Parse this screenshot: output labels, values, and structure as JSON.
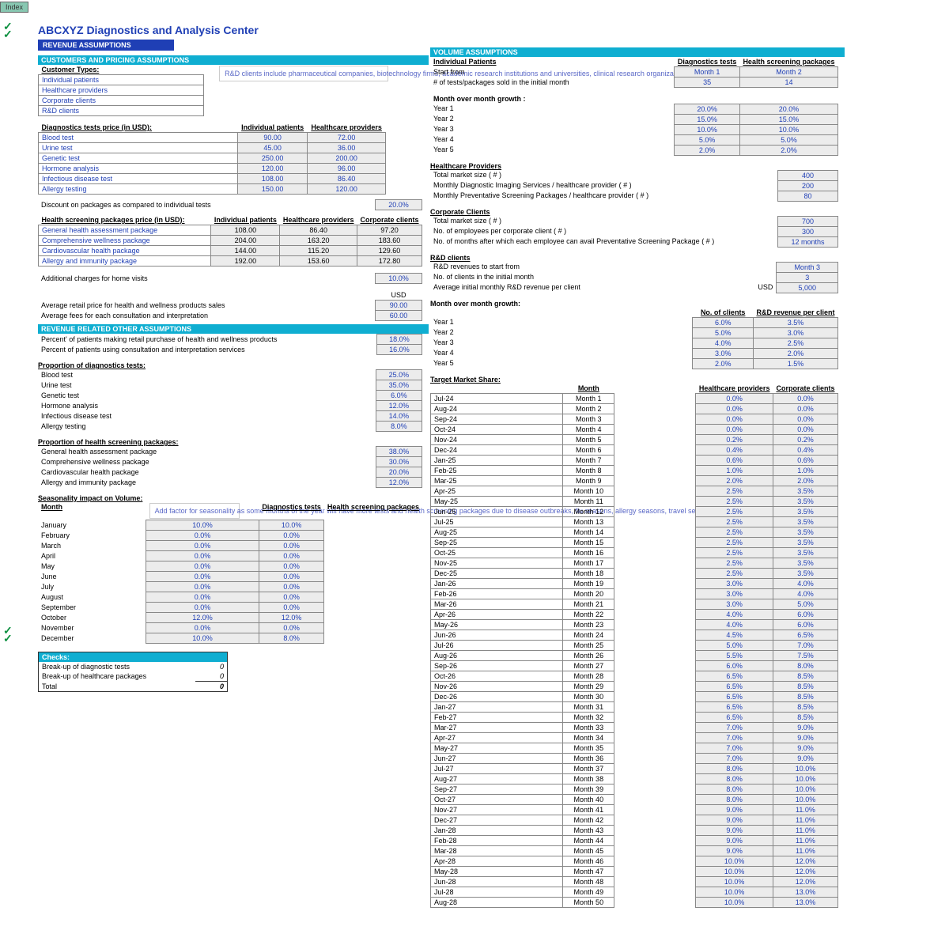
{
  "index_tab": "Index",
  "page_title": "ABCXYZ Diagnostics and Analysis Center",
  "section": "REVENUE ASSUMPTIONS",
  "left": {
    "cpa": "CUSTOMERS AND PRICING ASSUMPTIONS",
    "cust_types_hdr": "Customer Types:",
    "cust_types": [
      "Individual patients",
      "Healthcare providers",
      "Corporate clients",
      "R&D clients"
    ],
    "rnd_note": "R&D clients include pharmaceutical companies, biotechnology firms, academic research institutions and universities, clinical research organizations and non-profit organizations and foundations",
    "diag_hdr": "Diagnostics tests price (in USD):",
    "diag_cols": [
      "Individual patients",
      "Healthcare providers"
    ],
    "diag_rows": [
      {
        "n": "Blood test",
        "ip": "90.00",
        "hp": "72.00"
      },
      {
        "n": "Urine test",
        "ip": "45.00",
        "hp": "36.00"
      },
      {
        "n": "Genetic test",
        "ip": "250.00",
        "hp": "200.00"
      },
      {
        "n": "Hormone analysis",
        "ip": "120.00",
        "hp": "96.00"
      },
      {
        "n": "Infectious disease test",
        "ip": "108.00",
        "hp": "86.40"
      },
      {
        "n": "Allergy testing",
        "ip": "150.00",
        "hp": "120.00"
      }
    ],
    "discount_label": "Discount on packages as compared to individual tests",
    "discount_val": "20.0%",
    "pkg_hdr": "Health screening packages price (in USD):",
    "pkg_cols": [
      "Individual patients",
      "Healthcare providers",
      "Corporate clients"
    ],
    "pkg_rows": [
      {
        "n": "General health assessment package",
        "ip": "108.00",
        "hp": "86.40",
        "cc": "97.20"
      },
      {
        "n": "Comprehensive wellness package",
        "ip": "204.00",
        "hp": "163.20",
        "cc": "183.60"
      },
      {
        "n": "Cardiovascular health package",
        "ip": "144.00",
        "hp": "115.20",
        "cc": "129.60"
      },
      {
        "n": "Allergy and immunity package",
        "ip": "192.00",
        "hp": "153.60",
        "cc": "172.80"
      }
    ],
    "home_label": "Additional charges for home visits",
    "home_val": "10.0%",
    "avg_retail_label": "Average retail price for health and wellness products sales",
    "avg_retail_val": "90.00",
    "usd": "USD",
    "avg_fee_label": "Average fees for each consultation and interpretation",
    "avg_fee_val": "60.00",
    "rro": "REVENUE RELATED OTHER ASSUMPTIONS",
    "pct_rows": [
      {
        "l": "Percent' of patients making retail purchase of health and wellness products",
        "v": "18.0%"
      },
      {
        "l": "Percent of patients using consultation and interpretation services",
        "v": "16.0%"
      }
    ],
    "prop_diag_hdr": "Proportion of diagnostics tests:",
    "prop_diag": [
      {
        "l": "Blood test",
        "v": "25.0%"
      },
      {
        "l": "Urine test",
        "v": "35.0%"
      },
      {
        "l": "Genetic test",
        "v": "6.0%"
      },
      {
        "l": "Hormone analysis",
        "v": "12.0%"
      },
      {
        "l": "Infectious disease test",
        "v": "14.0%"
      },
      {
        "l": "Allergy testing",
        "v": "8.0%"
      }
    ],
    "prop_pkg_hdr": "Proportion of health screening packages:",
    "prop_pkg": [
      {
        "l": "General health assessment package",
        "v": "38.0%"
      },
      {
        "l": "Comprehensive wellness package",
        "v": "30.0%"
      },
      {
        "l": "Cardiovascular health package",
        "v": "20.0%"
      },
      {
        "l": "Allergy and immunity package",
        "v": "12.0%"
      }
    ],
    "season_hdr": "Seasonality impact on Volume:",
    "month_hdr": "Month",
    "season_cols": [
      "Diagnostics tests",
      "Health screening packages"
    ],
    "season": [
      {
        "m": "January",
        "a": "10.0%",
        "b": "10.0%"
      },
      {
        "m": "February",
        "a": "0.0%",
        "b": "0.0%"
      },
      {
        "m": "March",
        "a": "0.0%",
        "b": "0.0%"
      },
      {
        "m": "April",
        "a": "0.0%",
        "b": "0.0%"
      },
      {
        "m": "May",
        "a": "0.0%",
        "b": "0.0%"
      },
      {
        "m": "June",
        "a": "0.0%",
        "b": "0.0%"
      },
      {
        "m": "July",
        "a": "0.0%",
        "b": "0.0%"
      },
      {
        "m": "August",
        "a": "0.0%",
        "b": "0.0%"
      },
      {
        "m": "September",
        "a": "0.0%",
        "b": "0.0%"
      },
      {
        "m": "October",
        "a": "12.0%",
        "b": "12.0%"
      },
      {
        "m": "November",
        "a": "0.0%",
        "b": "0.0%"
      },
      {
        "m": "December",
        "a": "10.0%",
        "b": "8.0%"
      }
    ],
    "season_note": "Add factor for seasonality as some months of the year will have more tests and health screening packages due to disease outbreaks, flu seasons, allergy seasons, travel seasons etc.",
    "checks_hdr": "Checks:",
    "checks": [
      {
        "l": "Break-up of diagnostic tests",
        "v": "0"
      },
      {
        "l": "Break-up of healthcare packages",
        "v": "0"
      },
      {
        "l": "Total",
        "v": "0"
      }
    ]
  },
  "right": {
    "va": "VOLUME ASSUMPTIONS",
    "ip_hdr": "Individual Patients",
    "ip_cols": [
      "Diagnostics tests",
      "Health screening packages"
    ],
    "start_label": "Start from",
    "start": [
      "Month 1",
      "Month 2"
    ],
    "sold_label": "# of tests/packages sold in the initial month",
    "sold": [
      "35",
      "14"
    ],
    "mom_hdr": "Month over month growth :",
    "mom": [
      {
        "l": "Year 1",
        "a": "20.0%",
        "b": "20.0%"
      },
      {
        "l": "Year 2",
        "a": "15.0%",
        "b": "15.0%"
      },
      {
        "l": "Year 3",
        "a": "10.0%",
        "b": "10.0%"
      },
      {
        "l": "Year 4",
        "a": "5.0%",
        "b": "5.0%"
      },
      {
        "l": "Year 5",
        "a": "2.0%",
        "b": "2.0%"
      }
    ],
    "hp_hdr": "Healthcare Providers",
    "hp_rows": [
      {
        "l": "Total market size ( # )",
        "v": "400"
      },
      {
        "l": "Monthly Diagnostic Imaging Services / healthcare provider ( # )",
        "v": "200"
      },
      {
        "l": "Monthly Preventative Screening Packages / healthcare provider ( # )",
        "v": "80"
      }
    ],
    "cc_hdr": "Corporate Clients",
    "cc_rows": [
      {
        "l": "Total market size ( # )",
        "v": "700"
      },
      {
        "l": "No. of employees per corporate client ( # )",
        "v": "300"
      },
      {
        "l": "No. of months after which each employee can avail Preventative Screening Package ( # )",
        "v": "12 months"
      }
    ],
    "rd_hdr": "R&D clients",
    "rd_rows": [
      {
        "l": "R&D revenues to start from",
        "v": "Month 3"
      },
      {
        "l": "No. of clients in the initial month",
        "v": "3"
      },
      {
        "l": "Average initial monthly R&D revenue per client",
        "u": "USD",
        "v": "5,000"
      }
    ],
    "mom2_hdr": "Month over month growth:",
    "mom2_cols": [
      "No. of clients",
      "R&D revenue per client"
    ],
    "mom2": [
      {
        "l": "Year 1",
        "a": "6.0%",
        "b": "3.5%"
      },
      {
        "l": "Year 2",
        "a": "5.0%",
        "b": "3.0%"
      },
      {
        "l": "Year 3",
        "a": "4.0%",
        "b": "2.5%"
      },
      {
        "l": "Year 4",
        "a": "3.0%",
        "b": "2.0%"
      },
      {
        "l": "Year 5",
        "a": "2.0%",
        "b": "1.5%"
      }
    ],
    "tms_hdr": "Target Market Share:",
    "tms_cols": [
      "Month",
      "Healthcare providers",
      "Corporate clients"
    ],
    "tms": [
      {
        "d": "Jul-24",
        "m": "Month 1",
        "a": "0.0%",
        "b": "0.0%"
      },
      {
        "d": "Aug-24",
        "m": "Month 2",
        "a": "0.0%",
        "b": "0.0%"
      },
      {
        "d": "Sep-24",
        "m": "Month 3",
        "a": "0.0%",
        "b": "0.0%"
      },
      {
        "d": "Oct-24",
        "m": "Month 4",
        "a": "0.0%",
        "b": "0.0%"
      },
      {
        "d": "Nov-24",
        "m": "Month 5",
        "a": "0.2%",
        "b": "0.2%"
      },
      {
        "d": "Dec-24",
        "m": "Month 6",
        "a": "0.4%",
        "b": "0.4%"
      },
      {
        "d": "Jan-25",
        "m": "Month 7",
        "a": "0.6%",
        "b": "0.6%"
      },
      {
        "d": "Feb-25",
        "m": "Month 8",
        "a": "1.0%",
        "b": "1.0%"
      },
      {
        "d": "Mar-25",
        "m": "Month 9",
        "a": "2.0%",
        "b": "2.0%"
      },
      {
        "d": "Apr-25",
        "m": "Month 10",
        "a": "2.5%",
        "b": "3.5%"
      },
      {
        "d": "May-25",
        "m": "Month 11",
        "a": "2.5%",
        "b": "3.5%"
      },
      {
        "d": "Jun-25",
        "m": "Month 12",
        "a": "2.5%",
        "b": "3.5%"
      },
      {
        "d": "Jul-25",
        "m": "Month 13",
        "a": "2.5%",
        "b": "3.5%"
      },
      {
        "d": "Aug-25",
        "m": "Month 14",
        "a": "2.5%",
        "b": "3.5%"
      },
      {
        "d": "Sep-25",
        "m": "Month 15",
        "a": "2.5%",
        "b": "3.5%"
      },
      {
        "d": "Oct-25",
        "m": "Month 16",
        "a": "2.5%",
        "b": "3.5%"
      },
      {
        "d": "Nov-25",
        "m": "Month 17",
        "a": "2.5%",
        "b": "3.5%"
      },
      {
        "d": "Dec-25",
        "m": "Month 18",
        "a": "2.5%",
        "b": "3.5%"
      },
      {
        "d": "Jan-26",
        "m": "Month 19",
        "a": "3.0%",
        "b": "4.0%"
      },
      {
        "d": "Feb-26",
        "m": "Month 20",
        "a": "3.0%",
        "b": "4.0%"
      },
      {
        "d": "Mar-26",
        "m": "Month 21",
        "a": "3.0%",
        "b": "5.0%"
      },
      {
        "d": "Apr-26",
        "m": "Month 22",
        "a": "4.0%",
        "b": "6.0%"
      },
      {
        "d": "May-26",
        "m": "Month 23",
        "a": "4.0%",
        "b": "6.0%"
      },
      {
        "d": "Jun-26",
        "m": "Month 24",
        "a": "4.5%",
        "b": "6.5%"
      },
      {
        "d": "Jul-26",
        "m": "Month 25",
        "a": "5.0%",
        "b": "7.0%"
      },
      {
        "d": "Aug-26",
        "m": "Month 26",
        "a": "5.5%",
        "b": "7.5%"
      },
      {
        "d": "Sep-26",
        "m": "Month 27",
        "a": "6.0%",
        "b": "8.0%"
      },
      {
        "d": "Oct-26",
        "m": "Month 28",
        "a": "6.5%",
        "b": "8.5%"
      },
      {
        "d": "Nov-26",
        "m": "Month 29",
        "a": "6.5%",
        "b": "8.5%"
      },
      {
        "d": "Dec-26",
        "m": "Month 30",
        "a": "6.5%",
        "b": "8.5%"
      },
      {
        "d": "Jan-27",
        "m": "Month 31",
        "a": "6.5%",
        "b": "8.5%"
      },
      {
        "d": "Feb-27",
        "m": "Month 32",
        "a": "6.5%",
        "b": "8.5%"
      },
      {
        "d": "Mar-27",
        "m": "Month 33",
        "a": "7.0%",
        "b": "9.0%"
      },
      {
        "d": "Apr-27",
        "m": "Month 34",
        "a": "7.0%",
        "b": "9.0%"
      },
      {
        "d": "May-27",
        "m": "Month 35",
        "a": "7.0%",
        "b": "9.0%"
      },
      {
        "d": "Jun-27",
        "m": "Month 36",
        "a": "7.0%",
        "b": "9.0%"
      },
      {
        "d": "Jul-27",
        "m": "Month 37",
        "a": "8.0%",
        "b": "10.0%"
      },
      {
        "d": "Aug-27",
        "m": "Month 38",
        "a": "8.0%",
        "b": "10.0%"
      },
      {
        "d": "Sep-27",
        "m": "Month 39",
        "a": "8.0%",
        "b": "10.0%"
      },
      {
        "d": "Oct-27",
        "m": "Month 40",
        "a": "8.0%",
        "b": "10.0%"
      },
      {
        "d": "Nov-27",
        "m": "Month 41",
        "a": "9.0%",
        "b": "11.0%"
      },
      {
        "d": "Dec-27",
        "m": "Month 42",
        "a": "9.0%",
        "b": "11.0%"
      },
      {
        "d": "Jan-28",
        "m": "Month 43",
        "a": "9.0%",
        "b": "11.0%"
      },
      {
        "d": "Feb-28",
        "m": "Month 44",
        "a": "9.0%",
        "b": "11.0%"
      },
      {
        "d": "Mar-28",
        "m": "Month 45",
        "a": "9.0%",
        "b": "11.0%"
      },
      {
        "d": "Apr-28",
        "m": "Month 46",
        "a": "10.0%",
        "b": "12.0%"
      },
      {
        "d": "May-28",
        "m": "Month 47",
        "a": "10.0%",
        "b": "12.0%"
      },
      {
        "d": "Jun-28",
        "m": "Month 48",
        "a": "10.0%",
        "b": "12.0%"
      },
      {
        "d": "Jul-28",
        "m": "Month 49",
        "a": "10.0%",
        "b": "13.0%"
      },
      {
        "d": "Aug-28",
        "m": "Month 50",
        "a": "10.0%",
        "b": "13.0%"
      }
    ]
  }
}
